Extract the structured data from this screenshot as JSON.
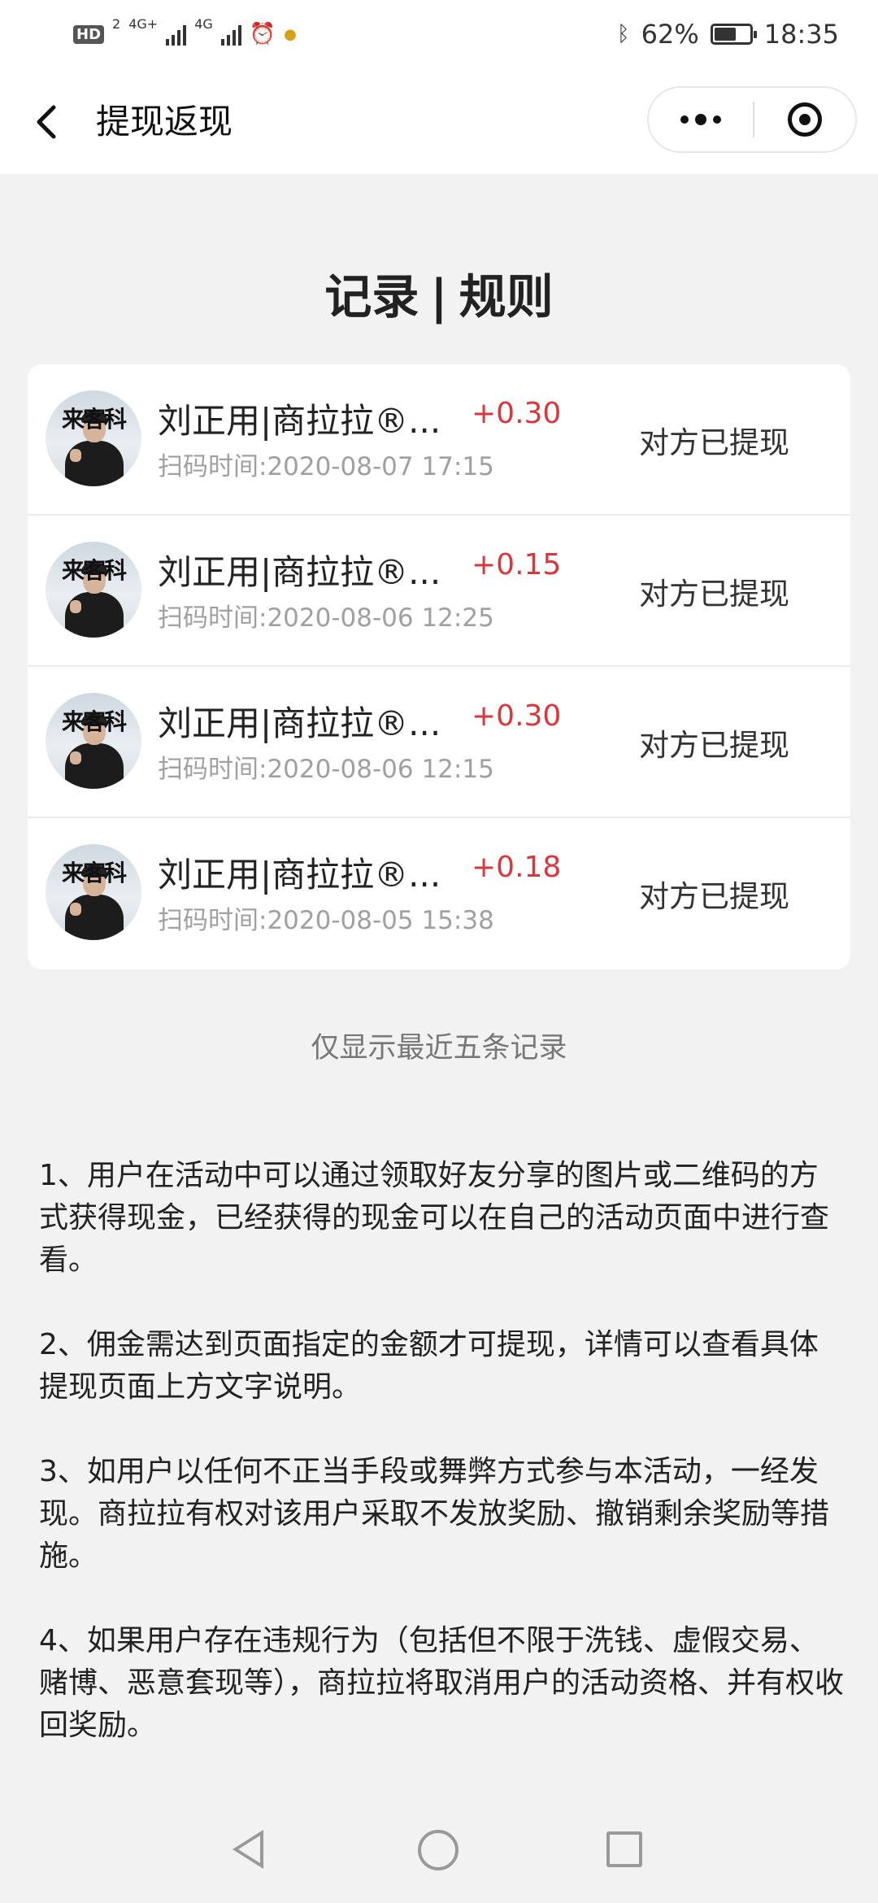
{
  "status_bar": {
    "hd": "HD",
    "hd_sub": "2",
    "net1": "4G+",
    "net2": "4G",
    "battery_percent": "62%",
    "battery_level": 0.62,
    "time": "18:35"
  },
  "header": {
    "title": "提现返现"
  },
  "tabs": {
    "records": "记录",
    "separator": "|",
    "rules": "规则"
  },
  "records": [
    {
      "name": "刘正用|商拉拉®...",
      "amount": "+0.30",
      "scan_time": "扫码时间:2020-08-07 17:15",
      "status": "对方已提现",
      "avatar_text": "来客科"
    },
    {
      "name": "刘正用|商拉拉®...",
      "amount": "+0.15",
      "scan_time": "扫码时间:2020-08-06 12:25",
      "status": "对方已提现",
      "avatar_text": "来客科"
    },
    {
      "name": "刘正用|商拉拉®...",
      "amount": "+0.30",
      "scan_time": "扫码时间:2020-08-06 12:15",
      "status": "对方已提现",
      "avatar_text": "来客科"
    },
    {
      "name": "刘正用|商拉拉®...",
      "amount": "+0.18",
      "scan_time": "扫码时间:2020-08-05 15:38",
      "status": "对方已提现",
      "avatar_text": "来客科"
    }
  ],
  "notice": "仅显示最近五条记录",
  "rules": [
    "1、用户在活动中可以通过领取好友分享的图片或二维码的方式获得现金，已经获得的现金可以在自己的活动页面中进行查看。",
    "2、佣金需达到页面指定的金额才可提现，详情可以查看具体提现页面上方文字说明。",
    "3、如用户以任何不正当手段或舞弊方式参与本活动，一经发现。商拉拉有权对该用户采取不发放奖励、撤销剩余奖励等措施。",
    "4、如果用户存在违规行为（包括但不限于洗钱、虚假交易、赌博、恶意套现等），商拉拉将取消用户的活动资格、并有权收回奖励。"
  ],
  "colors": {
    "amount": "#d9363e",
    "background": "#f2f2f2",
    "card": "#ffffff"
  },
  "icons": {
    "back": "chevron-left-icon",
    "more": "more-dots-icon",
    "close": "target-circle-icon",
    "bluetooth": "bluetooth-icon",
    "alarm": "alarm-icon"
  }
}
